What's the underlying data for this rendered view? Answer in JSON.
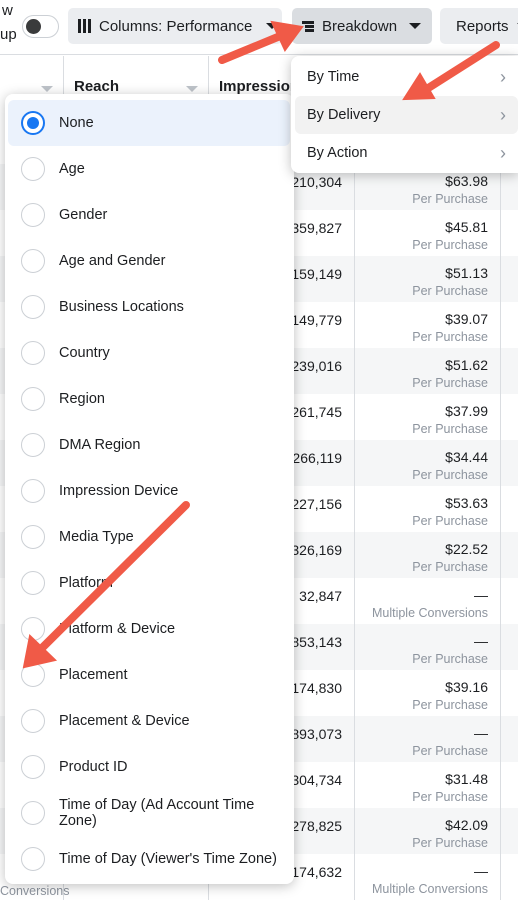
{
  "topbar": {
    "fragment_top": "w",
    "fragment_bottom": "up",
    "columns_label": "Columns: Performance",
    "breakdown_label": "Breakdown",
    "reports_label": "Reports"
  },
  "table": {
    "headers": [
      "",
      "Reach",
      "Impressions",
      ""
    ],
    "rows": [
      {
        "impressions": "210,304",
        "cost": "$63.98",
        "result_type": "Per Purchase"
      },
      {
        "impressions": "359,827",
        "cost": "$45.81",
        "result_type": "Per Purchase"
      },
      {
        "impressions": "159,149",
        "cost": "$51.13",
        "result_type": "Per Purchase"
      },
      {
        "impressions": "149,779",
        "cost": "$39.07",
        "result_type": "Per Purchase"
      },
      {
        "impressions": "239,016",
        "cost": "$51.62",
        "result_type": "Per Purchase"
      },
      {
        "impressions": "261,745",
        "cost": "$37.99",
        "result_type": "Per Purchase"
      },
      {
        "impressions": "266,119",
        "cost": "$34.44",
        "result_type": "Per Purchase"
      },
      {
        "impressions": "227,156",
        "cost": "$53.63",
        "result_type": "Per Purchase"
      },
      {
        "impressions": "326,169",
        "cost": "$22.52",
        "result_type": "Per Purchase"
      },
      {
        "impressions": "32,847",
        "cost": "—",
        "result_type": "Multiple Conversions"
      },
      {
        "impressions": "853,143",
        "cost": "—",
        "result_type": "Per Purchase"
      },
      {
        "impressions": "174,830",
        "cost": "$39.16",
        "result_type": "Per Purchase"
      },
      {
        "impressions": "893,073",
        "cost": "—",
        "result_type": "Per Purchase"
      },
      {
        "impressions": "304,734",
        "cost": "$31.48",
        "result_type": "Per Purchase"
      },
      {
        "impressions": "278,825",
        "cost": "$42.09",
        "result_type": "Per Purchase"
      },
      {
        "impressions": "174,632",
        "cost": "—",
        "result_type": "Multiple Conversions"
      }
    ],
    "left_fragment": "Conversions"
  },
  "breakdown_menu": {
    "items": [
      {
        "label": "By Time",
        "highlighted": false
      },
      {
        "label": "By Delivery",
        "highlighted": true
      },
      {
        "label": "By Action",
        "highlighted": false
      }
    ]
  },
  "delivery_options": {
    "selected": "None",
    "items": [
      "None",
      "Age",
      "Gender",
      "Age and Gender",
      "Business Locations",
      "Country",
      "Region",
      "DMA Region",
      "Impression Device",
      "Media Type",
      "Platform",
      "Platform & Device",
      "Placement",
      "Placement & Device",
      "Product ID",
      "Time of Day (Ad Account Time Zone)",
      "Time of Day (Viewer's Time Zone)"
    ]
  },
  "colors": {
    "accent": "#1877f2",
    "annotation_arrow": "#f05a47"
  }
}
